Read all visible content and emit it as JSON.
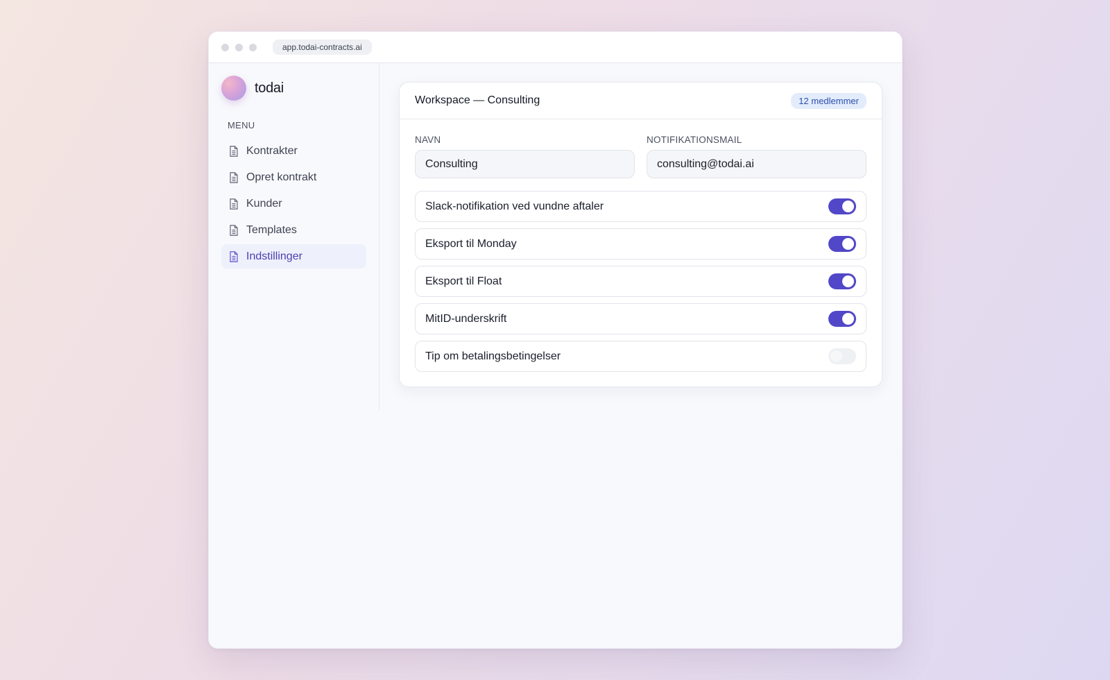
{
  "browser": {
    "url": "app.todai-contracts.ai"
  },
  "sidebar": {
    "brand": "todai",
    "menu_label": "MENU",
    "items": [
      {
        "label": "Kontrakter",
        "active": false
      },
      {
        "label": "Opret kontrakt",
        "active": false
      },
      {
        "label": "Kunder",
        "active": false
      },
      {
        "label": "Templates",
        "active": false
      },
      {
        "label": "Indstillinger",
        "active": true
      }
    ]
  },
  "workspace": {
    "title": "Workspace — Consulting",
    "members_badge": "12 medlemmer",
    "fields": {
      "name_label": "NAVN",
      "name_value": "Consulting",
      "email_label": "NOTIFIKATIONSMAIL",
      "email_value": "consulting@todai.ai"
    },
    "toggles": [
      {
        "label": "Slack-notifikation ved vundne aftaler",
        "on": true
      },
      {
        "label": "Eksport til Monday",
        "on": true
      },
      {
        "label": "Eksport til Float",
        "on": true
      },
      {
        "label": "MitID-underskrift",
        "on": true
      },
      {
        "label": "Tip om betalingsbetingelser",
        "on": false
      }
    ]
  },
  "colors": {
    "accent": "#5147c8",
    "active_nav_bg": "#eef1fc",
    "active_nav_text": "#4a3fb0",
    "badge_bg": "#e3ecfb",
    "badge_text": "#2c4fae"
  }
}
